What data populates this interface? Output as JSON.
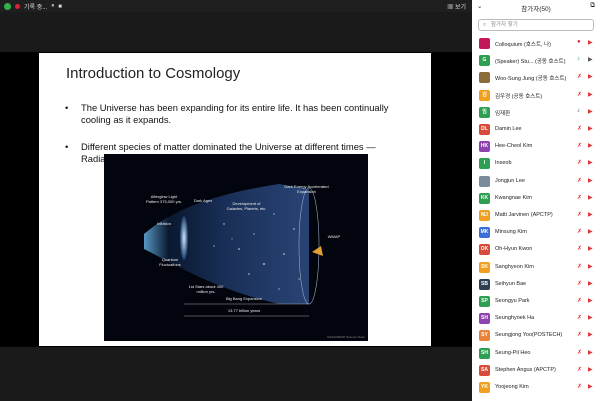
{
  "topbar": {
    "title": "기록 중...",
    "view_label": "보기",
    "colors": {
      "green": "#2fb24c",
      "red": "#d23"
    }
  },
  "slide": {
    "title": "Introduction to Cosmology",
    "bullet1": "The Universe has been expanding for its entire life. It has been continually cooling as it expands.",
    "bullet2": "Different species of matter dominated the Universe at different times — Radiation → Matter → Dark Energy.",
    "image_labels": {
      "afterglow": "Afterglow Light Pattern 375,000 yrs.",
      "dark_ages": "Dark Ages",
      "dark_energy": "Dark Energy Accelerated Expansion",
      "development": "Development of Galaxies, Planets, etc.",
      "inflation": "Inflation",
      "quantum": "Quantum Fluctuations",
      "first_stars": "1st Stars about 400 million yrs.",
      "wmap": "WMAP",
      "big_bang": "Big Bang Expansion",
      "years": "13.77 billion years",
      "credit": "NASA/WMAP Science Team"
    }
  },
  "panel": {
    "title": "참가자(50)",
    "search_placeholder": "참가자 찾기",
    "participants": [
      {
        "initials": "",
        "name": "Colloquium (호스트, 나)",
        "color": "#c2185b",
        "icons": "rec"
      },
      {
        "initials": "G",
        "name": "(Speaker) Stu... (공동 호스트)",
        "color": "#2e9e52",
        "icons": "spk"
      },
      {
        "initials": "",
        "name": "Woo-Sung Jung (공동 호스트)",
        "color": "#8a6d3b",
        "icons": "on"
      },
      {
        "initials": "김",
        "name": "김우경 (공동 호스트)",
        "color": "#f0a020",
        "icons": "on"
      },
      {
        "initials": "임",
        "name": "임재환",
        "color": "#2e9e52",
        "icons": "mic"
      },
      {
        "initials": "DL",
        "name": "Damin Lee",
        "color": "#d84c3a",
        "icons": "off"
      },
      {
        "initials": "HK",
        "name": "Hee-Cheol Kim",
        "color": "#8e44ad",
        "icons": "off"
      },
      {
        "initials": "I",
        "name": "Inseob",
        "color": "#2e9e52",
        "icons": "off"
      },
      {
        "initials": "",
        "name": "Jongjun Lee",
        "color": "#7a8a99",
        "icons": "off"
      },
      {
        "initials": "KK",
        "name": "Kwangnae Kim",
        "color": "#2e9e52",
        "icons": "off"
      },
      {
        "initials": "MJ",
        "name": "Matti Jarvinen (APCTP)",
        "color": "#f0a020",
        "icons": "off"
      },
      {
        "initials": "MK",
        "name": "Minsung Kim",
        "color": "#3a6fd8",
        "icons": "off"
      },
      {
        "initials": "OK",
        "name": "Oh-Hyun Kwon",
        "color": "#d84c3a",
        "icons": "off"
      },
      {
        "initials": "SK",
        "name": "Sanghyeon Kim",
        "color": "#f0a020",
        "icons": "off"
      },
      {
        "initials": "SB",
        "name": "Seihyun Bae",
        "color": "#2c3e50",
        "icons": "off"
      },
      {
        "initials": "SP",
        "name": "Seongyu Park",
        "color": "#2e9e52",
        "icons": "off"
      },
      {
        "initials": "SH",
        "name": "Seunghyoek Ha",
        "color": "#8e44ad",
        "icons": "off"
      },
      {
        "initials": "SY",
        "name": "Seungjong Yoo(POSTECH)",
        "color": "#e8833a",
        "icons": "off"
      },
      {
        "initials": "SH",
        "name": "Seung-Pil Heo",
        "color": "#2e9e52",
        "icons": "off"
      },
      {
        "initials": "SA",
        "name": "Stephen Angus (APCTP)",
        "color": "#d84c3a",
        "icons": "off"
      },
      {
        "initials": "YK",
        "name": "Yoojeong Kim",
        "color": "#f0a020",
        "icons": "off"
      }
    ]
  }
}
